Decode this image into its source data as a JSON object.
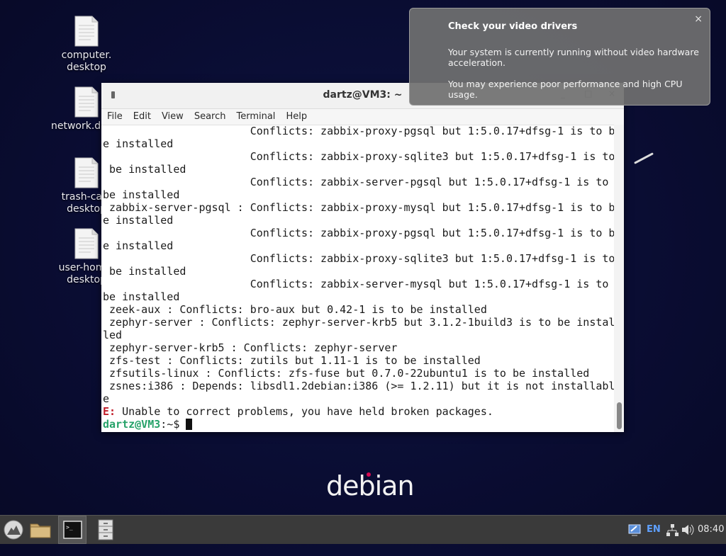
{
  "desktop": {
    "icons": [
      {
        "label": "computer.\ndesktop"
      },
      {
        "label": "network.desktop"
      },
      {
        "label": "trash-can.\ndesktop"
      },
      {
        "label": "user-home.\ndesktop"
      }
    ],
    "wallpaper_logo": "debian"
  },
  "terminal": {
    "title": "dartz@VM3: ~",
    "menu": [
      "File",
      "Edit",
      "View",
      "Search",
      "Terminal",
      "Help"
    ],
    "lines": [
      "                       Conflicts: zabbix-proxy-pgsql but 1:5.0.17+dfsg-1 is to b",
      "e installed",
      "                       Conflicts: zabbix-proxy-sqlite3 but 1:5.0.17+dfsg-1 is to",
      " be installed",
      "                       Conflicts: zabbix-server-pgsql but 1:5.0.17+dfsg-1 is to",
      "be installed",
      " zabbix-server-pgsql : Conflicts: zabbix-proxy-mysql but 1:5.0.17+dfsg-1 is to b",
      "e installed",
      "                       Conflicts: zabbix-proxy-pgsql but 1:5.0.17+dfsg-1 is to b",
      "e installed",
      "                       Conflicts: zabbix-proxy-sqlite3 but 1:5.0.17+dfsg-1 is to",
      " be installed",
      "                       Conflicts: zabbix-server-mysql but 1:5.0.17+dfsg-1 is to",
      "be installed",
      " zeek-aux : Conflicts: bro-aux but 0.42-1 is to be installed",
      " zephyr-server : Conflicts: zephyr-server-krb5 but 3.1.2-1build3 is to be instal",
      "led",
      " zephyr-server-krb5 : Conflicts: zephyr-server",
      " zfs-test : Conflicts: zutils but 1.11-1 is to be installed",
      " zfsutils-linux : Conflicts: zfs-fuse but 0.7.0-22ubuntu1 is to be installed",
      " zsnes:i386 : Depends: libsdl1.2debian:i386 (>= 1.2.11) but it is not installabl",
      "e"
    ],
    "error_prefix": "E:",
    "error_msg": " Unable to correct problems, you have held broken packages.",
    "prompt_user": "dartz@VM3",
    "prompt_rest": ":~$ "
  },
  "notification": {
    "title": "Check your video drivers",
    "body1": "Your system is currently running without video hardware acceleration.",
    "body2": "You may experience poor performance and high CPU usage.",
    "close": "×"
  },
  "taskbar": {
    "language": "EN",
    "clock": "08:40"
  }
}
